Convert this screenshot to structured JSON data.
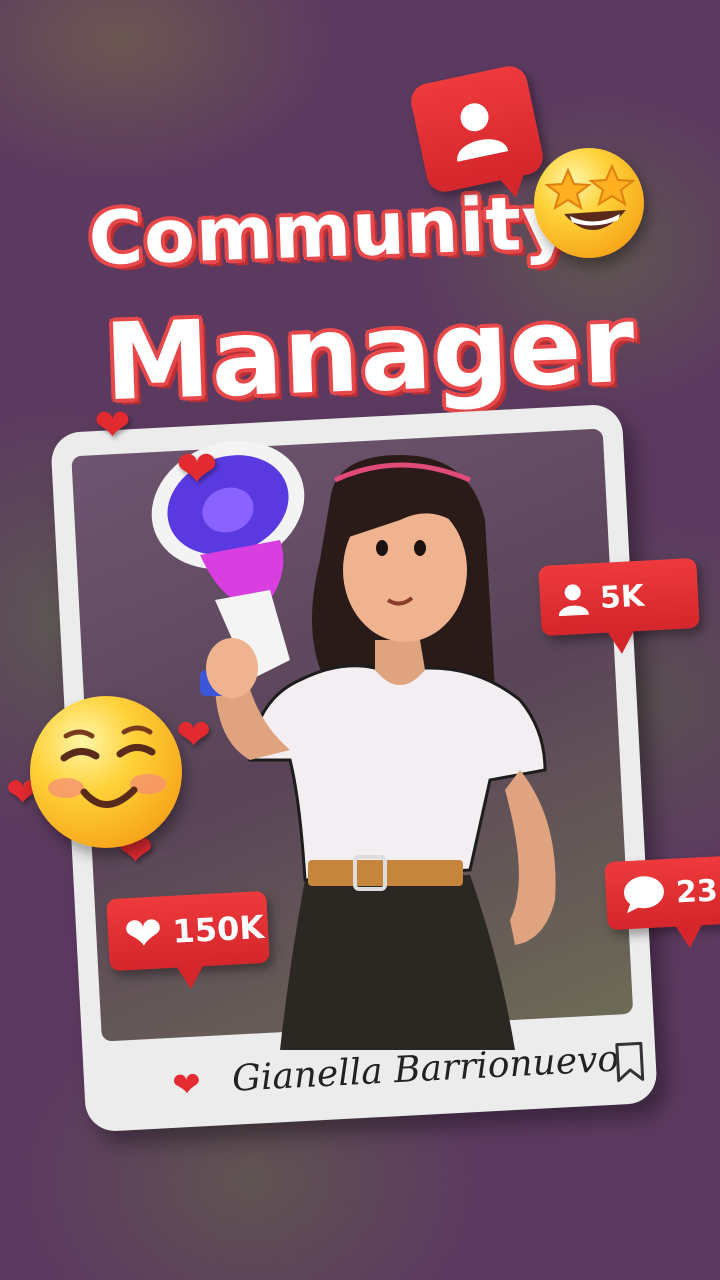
{
  "title": {
    "line1": "Community",
    "line2": "Manager"
  },
  "badges": {
    "followers": {
      "icon": "user-icon",
      "count": "5K"
    },
    "likes": {
      "icon": "heart-icon",
      "count": "150K"
    },
    "comments": {
      "icon": "comment-icon",
      "count": "23"
    },
    "top": {
      "icon": "user-icon"
    }
  },
  "post": {
    "name": "Gianella Barrionuevo",
    "like_icon": "heart-icon",
    "save_icon": "bookmark-icon"
  },
  "colors": {
    "background": "#5c3a60",
    "accent_red": "#e52b32",
    "frame": "#ececec",
    "title_text": "#ffffff"
  }
}
